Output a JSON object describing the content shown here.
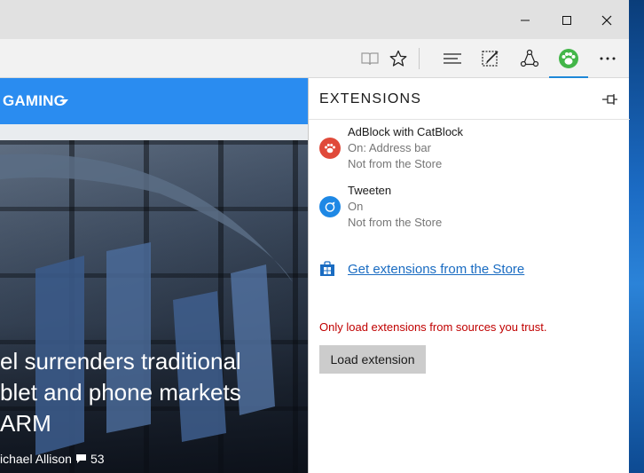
{
  "window": {
    "minimize_icon": "minimize-icon",
    "maximize_icon": "maximize-icon",
    "close_icon": "close-icon"
  },
  "toolbar": {
    "icons": [
      "reading-view-icon",
      "favorites-star-icon",
      "hub-icon",
      "web-note-icon",
      "share-icon",
      "catblock-extension-icon",
      "more-icon"
    ],
    "active_accent": "#1e88d8"
  },
  "page": {
    "nav_item": "GAMING",
    "nav_color": "#2a8cf0",
    "headline_lines": [
      "el surrenders traditional",
      "blet and phone markets",
      "ARM"
    ],
    "byline_author": "ichael Allison",
    "comment_count": "53"
  },
  "extensions_panel": {
    "title": "EXTENSIONS",
    "items": [
      {
        "name": "AdBlock with CatBlock",
        "status": "On: Address bar",
        "source": "Not from the Store",
        "icon": "catblock-paw-icon",
        "color": "#e04a3a"
      },
      {
        "name": "Tweeten",
        "status": "On",
        "source": "Not from the Store",
        "icon": "tweeten-bird-icon",
        "color": "#1e88e5"
      }
    ],
    "store_link": "Get extensions from the Store",
    "warning": "Only load extensions from sources you trust.",
    "warning_color": "#c00000",
    "load_button": "Load extension"
  }
}
